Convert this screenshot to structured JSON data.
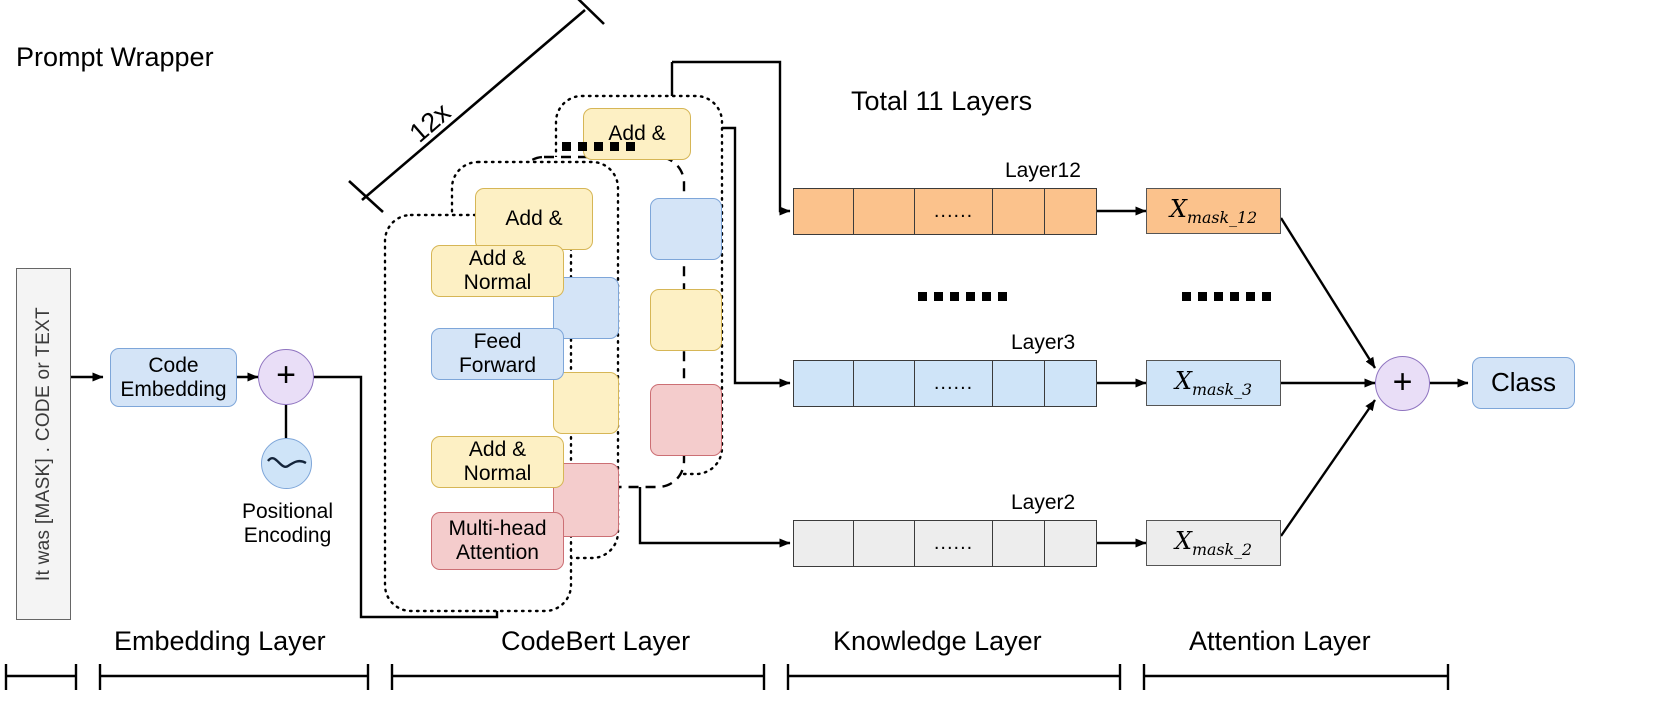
{
  "figure": {
    "title": "Prompt Wrapper",
    "total_layers_note": "Total 11 Layers",
    "repeat_badge": "12x"
  },
  "prompt": {
    "text": "It was [MASK] . CODE or TEXT"
  },
  "embedding": {
    "code_embedding": "Code\nEmbedding",
    "code_embedding_line1": "Code",
    "code_embedding_line2": "Embedding",
    "add_symbol": "+",
    "positional_encoding_line1": "Positional",
    "positional_encoding_line2": "Encoding",
    "sine_icon": "sine-wave-icon"
  },
  "codebert": {
    "blocks": [
      {
        "add_norm_top": "Add &\nNormal",
        "feed_forward": "Feed\nForward",
        "add_norm_bottom": "Add &\nNormal",
        "attention": "Multi-head\nAttention"
      }
    ],
    "add_norm_top_l1": "Add &",
    "add_norm_top_l2": "Normal",
    "feed_forward_l1": "Feed",
    "feed_forward_l2": "Forward",
    "add_norm_bottom_l1": "Add &",
    "add_norm_bottom_l2": "Normal",
    "attention_l1": "Multi-head",
    "attention_l2": "Attention",
    "stack_ellipsis": "......"
  },
  "knowledge": {
    "rows": [
      {
        "label": "Layer12",
        "color": "#fbc28c",
        "cells": [
          "",
          "",
          "......",
          "",
          ""
        ]
      },
      {
        "label": "Layer3",
        "color": "#cfe4f8",
        "cells": [
          "",
          "",
          "......",
          "",
          ""
        ]
      },
      {
        "label": "Layer2",
        "color": "#ededed",
        "cells": [
          "",
          "",
          "......",
          "",
          ""
        ]
      }
    ],
    "vertical_ellipsis": "......"
  },
  "attention": {
    "masks": [
      {
        "base": "X",
        "sub": "mask_12",
        "color": "#fbc28c"
      },
      {
        "base": "X",
        "sub": "mask_3",
        "color": "#cfe4f8"
      },
      {
        "base": "X",
        "sub": "mask_2",
        "color": "#ededed"
      }
    ],
    "vertical_ellipsis": "......",
    "sum_symbol": "+",
    "class_label": "Class"
  },
  "axis": {
    "sections": [
      {
        "label": "Embedding Layer"
      },
      {
        "label": "CodeBert Layer"
      },
      {
        "label": "Knowledge Layer"
      },
      {
        "label": "Attention Layer"
      }
    ]
  },
  "colors": {
    "yellow_fill": "#fdf0c4",
    "yellow_stroke": "#d6b656",
    "blue_fill": "#d4e4f7",
    "blue_stroke": "#7ea6d9",
    "red_fill": "#f4cccc",
    "red_stroke": "#cc6f74",
    "orange_fill": "#fbc28c",
    "gray_fill": "#ededed",
    "purple_fill": "#e9def7",
    "purple_stroke": "#8f74c0"
  }
}
